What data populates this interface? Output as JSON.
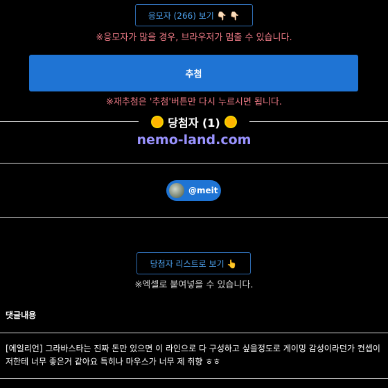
{
  "applicants_button": {
    "label": "응모자 (266) 보기 👇🏻 👇🏻"
  },
  "warning_browser": "※응모자가 많을 경우, 브라우저가 멈출 수 있습니다.",
  "draw_button": {
    "label": "추첨",
    "color": "#1f74d4"
  },
  "warning_redraw": "※재추첨은 '추첨'버튼만 다시 누르시면 됩니다.",
  "winners": {
    "title": "당첨자 (1)",
    "site": "nemo-land.com",
    "icon": "sun-icon",
    "site_color": "#9a93ff"
  },
  "winner_chip": {
    "handle": "@meit",
    "avatar": "avatar"
  },
  "winner_list_button": {
    "label": "당첨자 리스트로 보기 👆"
  },
  "excel_note": "※엑셀로 붙여넣을 수 있습니다.",
  "comments": {
    "header": "댓글내용",
    "items": [
      {
        "text": "[에일리언] 그라바스타는 진짜 돈만 있으면 이 라인으로 다 구성하고 싶을정도로 게이밍 감성이라던가 컨셉이 저한테 너무 좋은거 같아요 특히나 마우스가 너무 제 취향 ㅎㅎ"
      }
    ]
  }
}
